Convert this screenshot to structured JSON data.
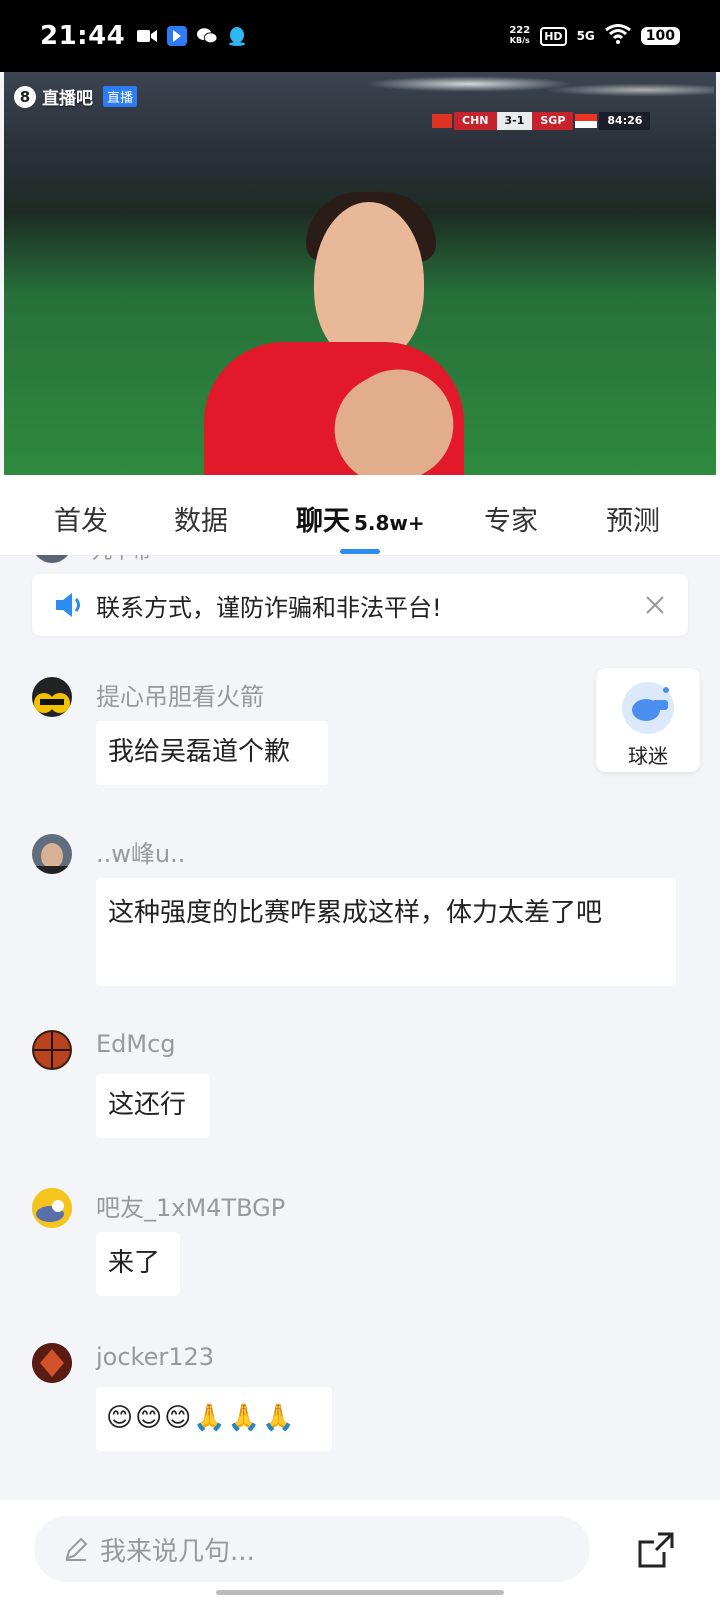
{
  "status_bar": {
    "time": "21:44",
    "net_speed_value": "222",
    "net_speed_unit": "KB/s",
    "hd": "HD",
    "signal": "5G",
    "battery": "100"
  },
  "video": {
    "logo_text": "直播吧",
    "logo_digit": "8",
    "live_badge": "直播",
    "score": {
      "home": "CHN",
      "result": "3-1",
      "away": "SGP",
      "clock": "84:26"
    }
  },
  "tabs": [
    {
      "label": "首发"
    },
    {
      "label": "数据"
    },
    {
      "label": "聊天",
      "count": "5.8w+",
      "active": true
    },
    {
      "label": "专家"
    },
    {
      "label": "预测"
    }
  ],
  "chat": {
    "partial_name": "九卞帝",
    "notice": "联系方式，谨防诈骗和非法平台!",
    "fan_label": "球迷",
    "messages": [
      {
        "user": "提心吊胆看火箭",
        "text": "我给吴磊道个歉"
      },
      {
        "user": "..w峰u..",
        "text": "这种强度的比赛咋累成这样，体力太差了吧"
      },
      {
        "user": "EdMcg",
        "text": "这还行"
      },
      {
        "user": "吧友_1xM4TBGP",
        "text": "来了"
      },
      {
        "user": "jocker123",
        "text": "😊😊😊🙏🙏🙏"
      }
    ]
  },
  "input": {
    "placeholder": "我来说几句..."
  },
  "colors": {
    "accent": "#2d8cf0",
    "chat_bg": "#f3f5f8",
    "live_badge": "#2d7cf6"
  }
}
